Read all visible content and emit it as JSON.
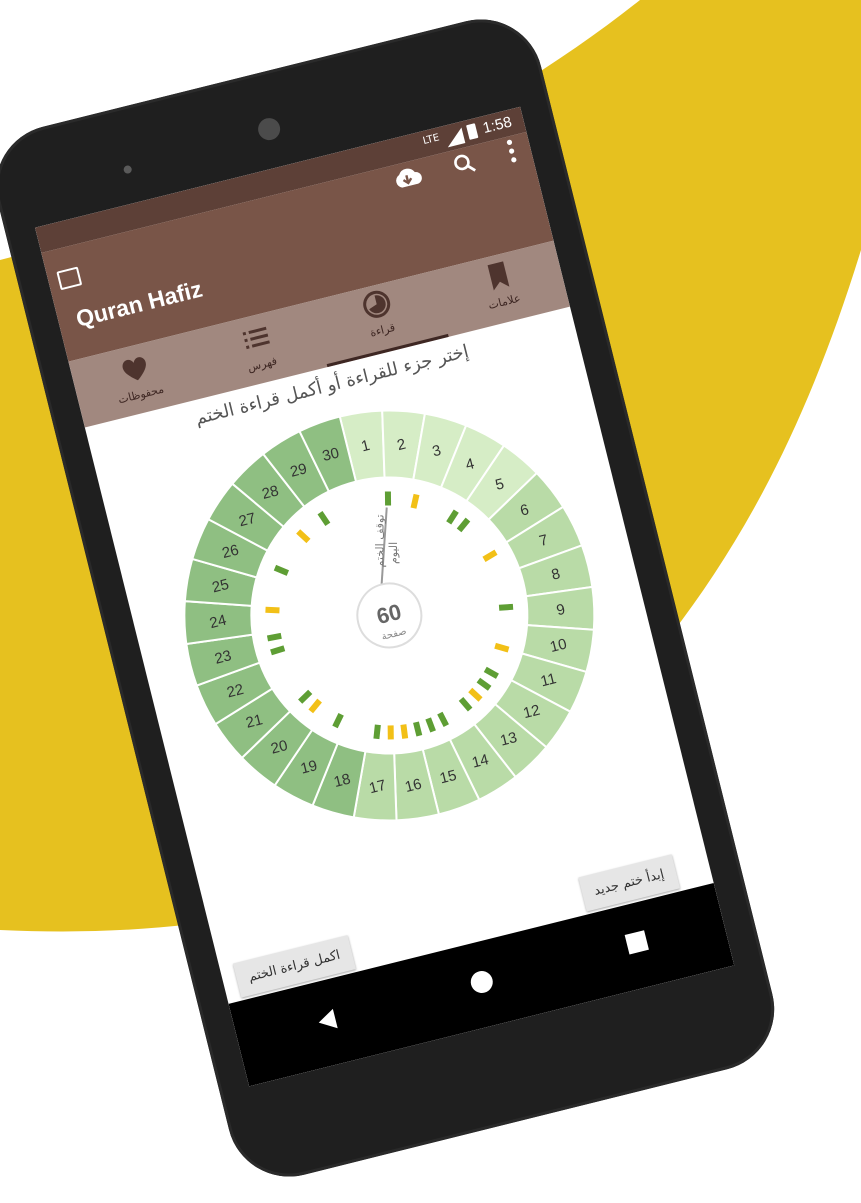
{
  "colors": {
    "yellow": "#e6c11f",
    "brown_dark": "#5d4037",
    "brown": "#795548",
    "brown_tab": "#a1887f",
    "green_light": "#d6edc6",
    "green_mid": "#b9dba7",
    "green_deep": "#8fbf82",
    "read_green": "#5e9e34",
    "read_yellow": "#f2c017"
  },
  "status_bar": {
    "network": "LTE",
    "time": "1:58"
  },
  "app_bar": {
    "title": "Quran Hafiz",
    "actions": [
      "cloud-download-icon",
      "search-icon",
      "more-vert-icon"
    ]
  },
  "tabs": [
    {
      "label": "محفوظات",
      "icon": "heart-icon"
    },
    {
      "label": "فهرس",
      "icon": "list-icon"
    },
    {
      "label": "قراءة",
      "icon": "progress-pie-icon",
      "active": true
    },
    {
      "label": "علامات",
      "icon": "bookmark-icon"
    }
  ],
  "heading": "إختر جزء للقراءة أو أكمل قراءة الختم",
  "wheel": {
    "juz": [
      "1",
      "2",
      "3",
      "4",
      "5",
      "6",
      "7",
      "8",
      "9",
      "10",
      "11",
      "12",
      "13",
      "14",
      "15",
      "16",
      "17",
      "18",
      "19",
      "20",
      "21",
      "22",
      "23",
      "24",
      "25",
      "26",
      "27",
      "28",
      "29",
      "30"
    ],
    "outer_labels": [
      "توقف الختم",
      "اليوم"
    ],
    "center_value": "60",
    "center_unit": "صفحة"
  },
  "buttons": {
    "new_khatm": "إبدأ ختم جديد",
    "continue_khatm": "اكمل قراءة الختم"
  }
}
